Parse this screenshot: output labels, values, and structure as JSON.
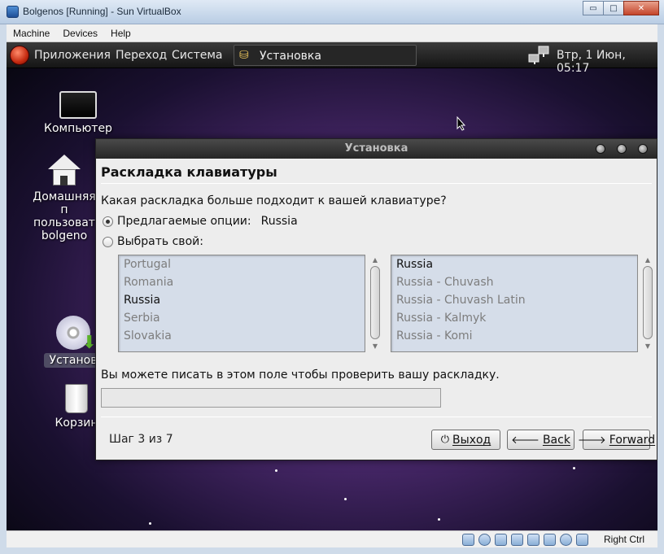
{
  "vbox": {
    "title": "Bolgenos [Running] - Sun VirtualBox",
    "menu": [
      "Machine",
      "Devices",
      "Help"
    ],
    "window_buttons": {
      "minimize": "▭",
      "maximize": "□",
      "close": "✕"
    },
    "host_key": "Right Ctrl"
  },
  "panel": {
    "menus": [
      "Приложения",
      "Переход",
      "Система"
    ],
    "task": "Установка",
    "clock": "Втр,  1 Июн, 05:17"
  },
  "desktop": {
    "icons": [
      {
        "label": "Компьютер"
      },
      {
        "label": "Домашняя п\nпользоват\nbolgeno"
      },
      {
        "label": "Установ"
      },
      {
        "label": "Корзин"
      }
    ]
  },
  "dialog": {
    "title": "Установка",
    "heading": "Раскладка клавиатуры",
    "question": "Какая раскладка больше подходит к вашей клавиатуре?",
    "suggested_label": "Предлагаемые опции:",
    "suggested_value": "Russia",
    "choose_label": "Выбрать свой:",
    "selected_option": "suggested",
    "countries": [
      "Portugal",
      "Romania",
      "Russia",
      "Serbia",
      "Slovakia"
    ],
    "selected_country": "Russia",
    "variants": [
      "Russia",
      "Russia - Chuvash",
      "Russia - Chuvash Latin",
      "Russia - Kalmyk",
      "Russia - Komi"
    ],
    "selected_variant": "Russia",
    "test_hint": "Вы можете писать в этом поле чтобы проверить вашу раскладку.",
    "test_value": "",
    "step": "Шаг 3 из 7",
    "buttons": {
      "quit": "Выход",
      "back": "Back",
      "forward": "Forward"
    }
  },
  "colors": {
    "dialog_bg": "#ededed",
    "list_bg": "#d5dde9",
    "panel_bg": "#1f1f1f"
  }
}
